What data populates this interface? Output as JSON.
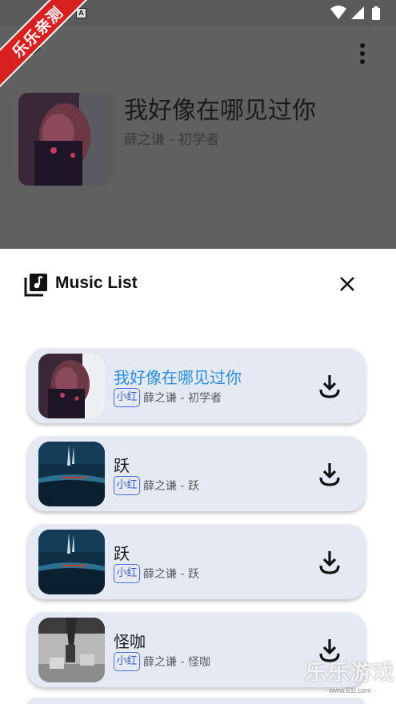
{
  "ribbon": {
    "label": "乐乐亲测"
  },
  "status_bar": {
    "notification_glyph": "A",
    "icons": [
      "wifi-icon",
      "cellular-signal-icon",
      "battery-icon"
    ]
  },
  "now_playing": {
    "title": "我好像在哪见过你",
    "artist": "薛之谦 - 初学者",
    "icons": [
      "chevron-down-icon",
      "more-vert-icon"
    ]
  },
  "sheet": {
    "title": "Music List",
    "icon": "music-library-icon",
    "close_icon": "close-icon"
  },
  "playlist": [
    {
      "title": "我好像在哪见过你",
      "badge": "小红",
      "artist": "薛之谦 - 初学者",
      "active": true
    },
    {
      "title": "跃",
      "badge": "小红",
      "artist": "薛之谦 - 跃",
      "active": false
    },
    {
      "title": "跃",
      "badge": "小红",
      "artist": "薛之谦 - 跃",
      "active": false
    },
    {
      "title": "怪咖",
      "badge": "小红",
      "artist": "薛之谦 - 怪咖",
      "active": false
    }
  ],
  "colors": {
    "accent": "#2a8de0",
    "badge": "#3a5fcc",
    "row_bg": "#e4e9f4",
    "ribbon": "#d92020"
  },
  "watermark": {
    "main": "乐乐游戏",
    "sub": "- www.61l.com -"
  }
}
